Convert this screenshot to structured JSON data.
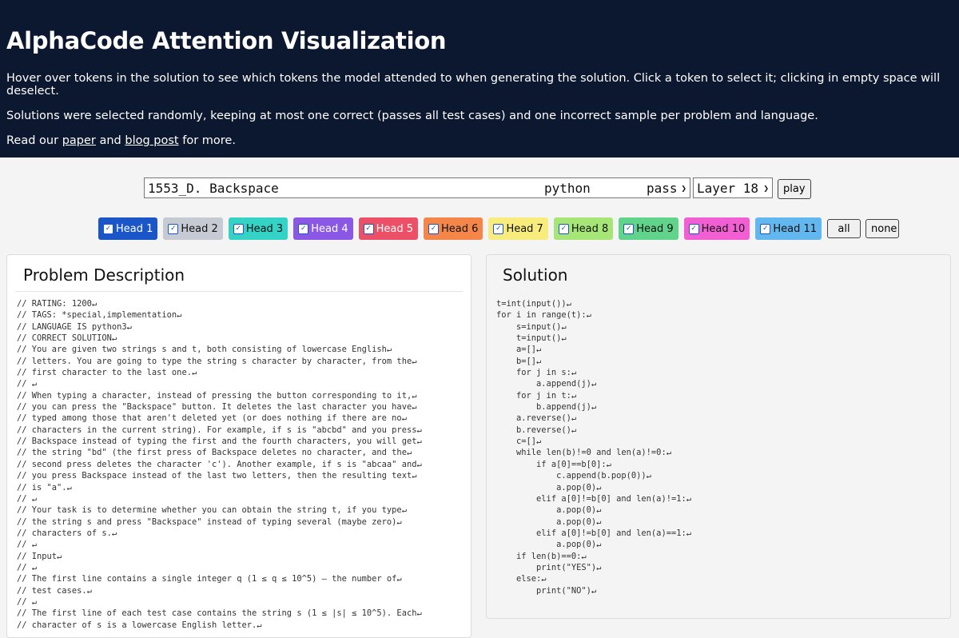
{
  "header": {
    "title": "AlphaCode Attention Visualization",
    "line1": "Hover over tokens in the solution to see which tokens the model attended to when generating the solution. Click a token to select it; clicking in empty space will deselect.",
    "line2": "Solutions were selected randomly, keeping at most one correct (passes all test cases) and one incorrect sample per problem and language.",
    "line3_prefix": "Read our ",
    "paper_link": "paper",
    "line3_and": " and ",
    "blog_link": "blog post",
    "line3_suffix": " for more."
  },
  "controls": {
    "problem": "1553_D. Backspace",
    "language": "python",
    "status": "pass",
    "layer": "Layer 18",
    "play_label": "play"
  },
  "heads": [
    {
      "label": "Head 1",
      "color": "#1a56c8",
      "text": "#ffffff"
    },
    {
      "label": "Head 2",
      "color": "#c5cad3",
      "text": "#111111"
    },
    {
      "label": "Head 3",
      "color": "#34d3c6",
      "text": "#111111"
    },
    {
      "label": "Head 4",
      "color": "#8b58e6",
      "text": "#ffffff"
    },
    {
      "label": "Head 5",
      "color": "#ec5066",
      "text": "#ffffff"
    },
    {
      "label": "Head 6",
      "color": "#f4864a",
      "text": "#111111"
    },
    {
      "label": "Head 7",
      "color": "#f7ec7c",
      "text": "#111111"
    },
    {
      "label": "Head 8",
      "color": "#a6e676",
      "text": "#111111"
    },
    {
      "label": "Head 9",
      "color": "#5fd48a",
      "text": "#111111"
    },
    {
      "label": "Head 10",
      "color": "#f25fd3",
      "text": "#111111"
    },
    {
      "label": "Head 11",
      "color": "#62b7ee",
      "text": "#111111"
    }
  ],
  "head_buttons": {
    "all": "all",
    "none": "none"
  },
  "problem_panel": {
    "title": "Problem Description",
    "lines": [
      "// RATING: 1200↵",
      "// TAGS: *special,implementation↵",
      "// LANGUAGE IS python3↵",
      "// CORRECT SOLUTION↵",
      "// You are given two strings s and t, both consisting of lowercase English↵",
      "// letters. You are going to type the string s character by character, from the↵",
      "// first character to the last one.↵",
      "// ↵",
      "// When typing a character, instead of pressing the button corresponding to it,↵",
      "// you can press the \"Backspace\" button. It deletes the last character you have↵",
      "// typed among those that aren't deleted yet (or does nothing if there are no↵",
      "// characters in the current string). For example, if s is \"abcbd\" and you press↵",
      "// Backspace instead of typing the first and the fourth characters, you will get↵",
      "// the string \"bd\" (the first press of Backspace deletes no character, and the↵",
      "// second press deletes the character 'c'). Another example, if s is \"abcaa\" and↵",
      "// you press Backspace instead of the last two letters, then the resulting text↵",
      "// is \"a\".↵",
      "// ↵",
      "// Your task is to determine whether you can obtain the string t, if you type↵",
      "// the string s and press \"Backspace\" instead of typing several (maybe zero)↵",
      "// characters of s.↵",
      "// ↵",
      "// Input↵",
      "// ↵",
      "// The first line contains a single integer q (1 ≤ q ≤ 10^5) — the number of↵",
      "// test cases.↵",
      "// ↵",
      "// The first line of each test case contains the string s (1 ≤ |s| ≤ 10^5). Each↵",
      "// character of s is a lowercase English letter.↵"
    ]
  },
  "solution_panel": {
    "title": "Solution",
    "lines": [
      "t=int(input())↵",
      "for i in range(t):↵",
      "    s=input()↵",
      "    t=input()↵",
      "    a=[]↵",
      "    b=[]↵",
      "    for j in s:↵",
      "        a.append(j)↵",
      "    for j in t:↵",
      "        b.append(j)↵",
      "    a.reverse()↵",
      "    b.reverse()↵",
      "    c=[]↵",
      "    while len(b)!=0 and len(a)!=0:↵",
      "        if a[0]==b[0]:↵",
      "            c.append(b.pop(0))↵",
      "            a.pop(0)↵",
      "        elif a[0]!=b[0] and len(a)!=1:↵",
      "            a.pop(0)↵",
      "            a.pop(0)↵",
      "        elif a[0]!=b[0] and len(a)==1:↵",
      "            a.pop(0)↵",
      "    if len(b)==0:↵",
      "        print(\"YES\")↵",
      "    else:↵",
      "        print(\"NO\")↵"
    ]
  }
}
